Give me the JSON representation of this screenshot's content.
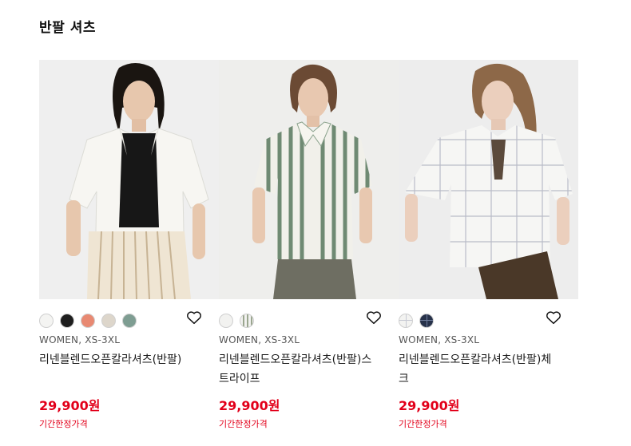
{
  "section": {
    "title": "반팔 셔츠"
  },
  "products": [
    {
      "meta": "WOMEN, XS-3XL",
      "name": "리넨블렌드오픈칼라셔츠(반팔)",
      "price": "29,900원",
      "flag": "기간한정가격",
      "swatches": [
        "#f4f4f2",
        "#1e1e1e",
        "#e88972",
        "#ddd6cb",
        "#7e9d92"
      ]
    },
    {
      "meta": "WOMEN, XS-3XL",
      "name": "리넨블렌드오픈칼라셔츠(반팔)스트라이프",
      "price": "29,900원",
      "flag": "기간한정가격",
      "swatches": [
        "#f2f2f0",
        "#c9cdbf"
      ]
    },
    {
      "meta": "WOMEN, XS-3XL",
      "name": "리넨블렌드오픈칼라셔츠(반팔)체크",
      "price": "29,900원",
      "flag": "기간한정가격",
      "swatches": [
        "#f3f3f1",
        "#27324a"
      ]
    }
  ]
}
